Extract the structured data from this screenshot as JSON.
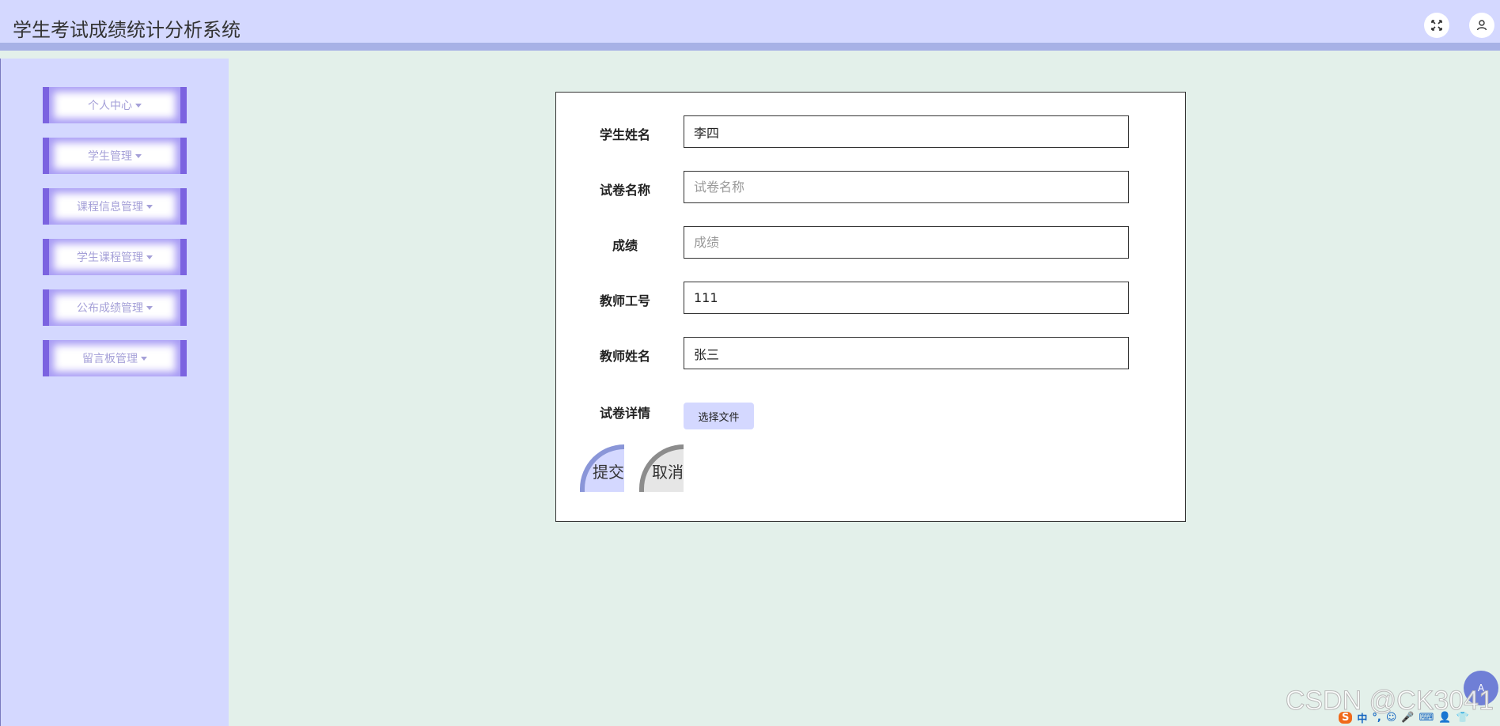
{
  "header": {
    "title": "学生考试成绩统计分析系统",
    "fullscreen_icon": "expand-icon",
    "user_icon": "user-icon"
  },
  "sidebar": {
    "items": [
      {
        "label": "个人中心"
      },
      {
        "label": "学生管理"
      },
      {
        "label": "课程信息管理"
      },
      {
        "label": "学生课程管理"
      },
      {
        "label": "公布成绩管理"
      },
      {
        "label": "留言板管理"
      }
    ]
  },
  "form": {
    "student_name": {
      "label": "学生姓名",
      "value": "李四",
      "placeholder": "学生姓名"
    },
    "paper_name": {
      "label": "试卷名称",
      "value": "",
      "placeholder": "试卷名称"
    },
    "score": {
      "label": "成绩",
      "value": "",
      "placeholder": "成绩"
    },
    "teacher_id": {
      "label": "教师工号",
      "value": "111",
      "placeholder": "教师工号"
    },
    "teacher_name": {
      "label": "教师姓名",
      "value": "张三",
      "placeholder": "教师姓名"
    },
    "paper_detail": {
      "label": "试卷详情",
      "button": "选择文件"
    },
    "submit": "提交",
    "cancel": "取消"
  },
  "overlay": {
    "watermark": "CSDN @CK3041",
    "ime_items": [
      "S",
      "中",
      "°,",
      "☺",
      "🎤",
      "⌨",
      "👤",
      "👕"
    ],
    "badge": "A"
  },
  "colors": {
    "header_bg": "#d4d8ff",
    "header_border": "#a7b1e6",
    "content_bg": "#e3f0ea",
    "menu_border": "#7b63e0",
    "menu_text": "#a5a0d8"
  }
}
